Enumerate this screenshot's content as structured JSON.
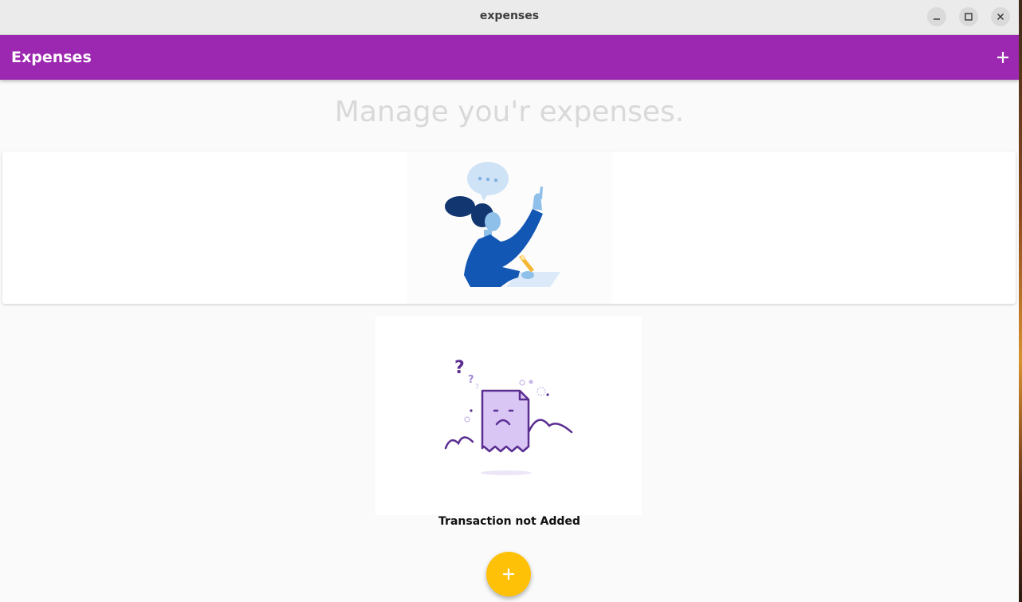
{
  "window": {
    "title": "expenses",
    "controls": [
      "minimize-icon",
      "maximize-icon",
      "close-icon"
    ]
  },
  "appbar": {
    "title": "Expenses",
    "action_icon": "plus-icon",
    "color": "#9c27b0"
  },
  "main": {
    "heading": "Manage you'r expenses.",
    "empty_state_text": "Transaction not Added"
  },
  "fab": {
    "icon": "plus-icon",
    "color": "#ffc107"
  }
}
